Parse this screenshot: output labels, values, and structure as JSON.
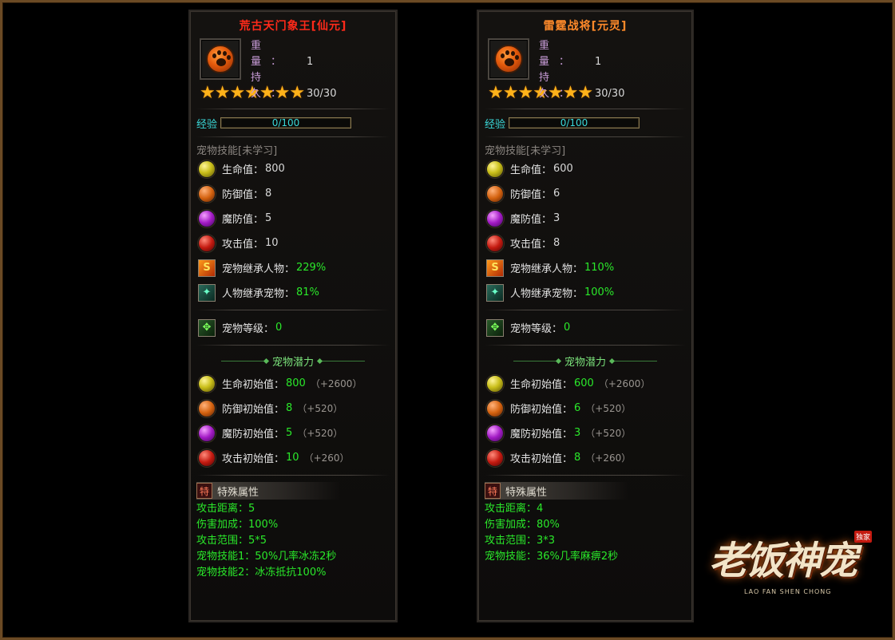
{
  "pets": [
    {
      "name": "荒古天门象王[仙元]",
      "weight_key": "重  量：",
      "weight_val": "1",
      "dura_key": "持  久：",
      "dura_val": "30/30",
      "stars": "★★★★★★★",
      "exp_label": "经验",
      "exp_text": "0/100",
      "exp_progress": 0,
      "skill_header": "宠物技能[未学习]",
      "stats": [
        {
          "k": "生命值：",
          "v": "800"
        },
        {
          "k": "防御值：",
          "v": "8"
        },
        {
          "k": "魔防值：",
          "v": "5"
        },
        {
          "k": "攻击值：",
          "v": "10"
        }
      ],
      "inherit": [
        {
          "k": "宠物继承人物：",
          "v": "229%"
        },
        {
          "k": "人物继承宠物：",
          "v": "81%"
        }
      ],
      "level": {
        "k": "宠物等级：",
        "v": "0"
      },
      "potential_header": "宠物潜力",
      "potential": [
        {
          "k": "生命初始值：",
          "v": "800",
          "b": "（+2600）"
        },
        {
          "k": "防御初始值：",
          "v": "8",
          "b": "（+520）"
        },
        {
          "k": "魔防初始值：",
          "v": "5",
          "b": "（+520）"
        },
        {
          "k": "攻击初始值：",
          "v": "10",
          "b": "（+260）"
        }
      ],
      "special_tag": "特",
      "special_header": "特殊属性",
      "special": [
        "攻击距离：5",
        "伤害加成：100%",
        "攻击范围：5*5",
        "宠物技能1：50%几率冰冻2秒",
        "宠物技能2：冰冻抵抗100%"
      ]
    },
    {
      "name": "雷霆战将[元灵]",
      "weight_key": "重  量：",
      "weight_val": "1",
      "dura_key": "持  久：",
      "dura_val": "30/30",
      "stars": "★★★★★★★",
      "exp_label": "经验",
      "exp_text": "0/100",
      "exp_progress": 0,
      "skill_header": "宠物技能[未学习]",
      "stats": [
        {
          "k": "生命值：",
          "v": "600"
        },
        {
          "k": "防御值：",
          "v": "6"
        },
        {
          "k": "魔防值：",
          "v": "3"
        },
        {
          "k": "攻击值：",
          "v": "8"
        }
      ],
      "inherit": [
        {
          "k": "宠物继承人物：",
          "v": "110%"
        },
        {
          "k": "人物继承宠物：",
          "v": "100%"
        }
      ],
      "level": {
        "k": "宠物等级：",
        "v": "0"
      },
      "potential_header": "宠物潜力",
      "potential": [
        {
          "k": "生命初始值：",
          "v": "600",
          "b": "（+2600）"
        },
        {
          "k": "防御初始值：",
          "v": "6",
          "b": "（+520）"
        },
        {
          "k": "魔防初始值：",
          "v": "3",
          "b": "（+520）"
        },
        {
          "k": "攻击初始值：",
          "v": "8",
          "b": "（+260）"
        }
      ],
      "special_tag": "特",
      "special_header": "特殊属性",
      "special": [
        "攻击距离：4",
        "伤害加成：80%",
        "攻击范围：3*3",
        "宠物技能：36%几率麻痹2秒"
      ]
    }
  ],
  "logo": {
    "main": "老饭神宠",
    "sub": "LAO FAN SHEN CHONG",
    "badge": "独家"
  },
  "icons": {
    "pet_icon": "paw-icon",
    "hp": "yellow-orb-icon",
    "def": "orange-orb-icon",
    "mdef": "purple-orb-icon",
    "atk": "red-orb-icon",
    "inherit1": "fire-square-icon",
    "inherit2": "green-square-icon",
    "level": "level-square-icon"
  }
}
